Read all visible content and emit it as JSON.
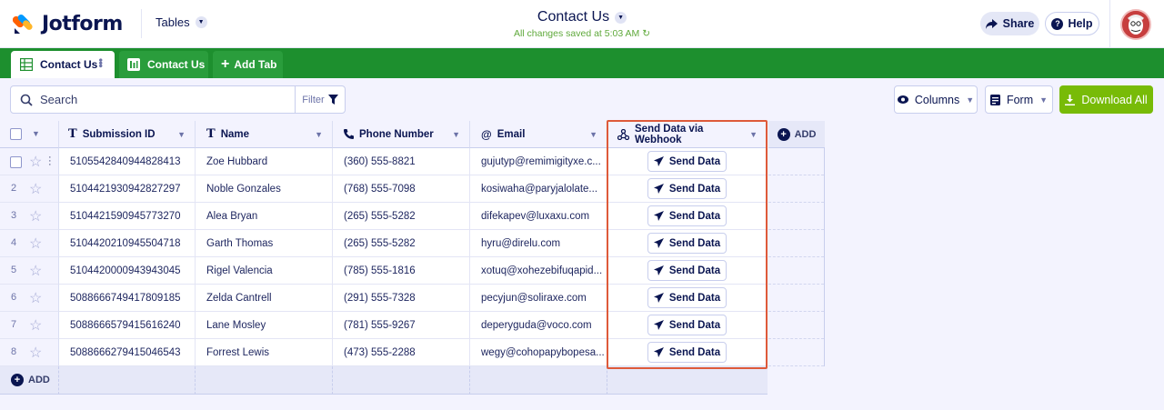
{
  "header": {
    "logo_text": "Jotform",
    "tables_label": "Tables",
    "title": "Contact Us",
    "saved_status": "All changes saved at 5:03 AM",
    "share_label": "Share",
    "help_label": "Help"
  },
  "tabs": [
    {
      "label": "Contact Us"
    },
    {
      "label": "Contact Us"
    },
    {
      "label": "Add Tab"
    }
  ],
  "toolbar": {
    "search_placeholder": "Search",
    "filter_label": "Filter",
    "columns_label": "Columns",
    "form_label": "Form",
    "download_label": "Download All"
  },
  "columns": [
    {
      "label": "Submission ID",
      "icon": "text-type-icon"
    },
    {
      "label": "Name",
      "icon": "text-type-icon"
    },
    {
      "label": "Phone Number",
      "icon": "phone-icon"
    },
    {
      "label": "Email",
      "icon": "at-icon"
    },
    {
      "label": "Send Data via Webhook",
      "icon": "webhook-icon"
    }
  ],
  "add_column_label": "ADD",
  "add_row_label": "ADD",
  "send_button_label": "Send Data",
  "rows": [
    {
      "num": "1",
      "id": "5105542840944828413",
      "name": "Zoe Hubbard",
      "phone": "(360) 555-8821",
      "email": "gujutyp@remimigityxe.c..."
    },
    {
      "num": "2",
      "id": "5104421930942827297",
      "name": "Noble Gonzales",
      "phone": "(768) 555-7098",
      "email": "kosiwaha@paryjalolate..."
    },
    {
      "num": "3",
      "id": "5104421590945773270",
      "name": "Alea Bryan",
      "phone": "(265) 555-5282",
      "email": "difekapev@luxaxu.com"
    },
    {
      "num": "4",
      "id": "5104420210945504718",
      "name": "Garth Thomas",
      "phone": "(265) 555-5282",
      "email": "hyru@direlu.com"
    },
    {
      "num": "5",
      "id": "5104420000943943045",
      "name": "Rigel Valencia",
      "phone": "(785) 555-1816",
      "email": "xotuq@xohezebifuqapid..."
    },
    {
      "num": "6",
      "id": "5088666749417809185",
      "name": "Zelda Cantrell",
      "phone": "(291) 555-7328",
      "email": "pecyjun@soliraxe.com"
    },
    {
      "num": "7",
      "id": "5088666579415616240",
      "name": "Lane Mosley",
      "phone": "(781) 555-9267",
      "email": "deperyguda@voco.com"
    },
    {
      "num": "8",
      "id": "5088666279415046543",
      "name": "Forrest Lewis",
      "phone": "(473) 555-2288",
      "email": "wegy@cohopapybopesa..."
    }
  ],
  "colors": {
    "brand_green": "#1d8f2e",
    "download_green": "#78bb07",
    "highlight": "#de5a3a",
    "navy": "#0a1551"
  }
}
